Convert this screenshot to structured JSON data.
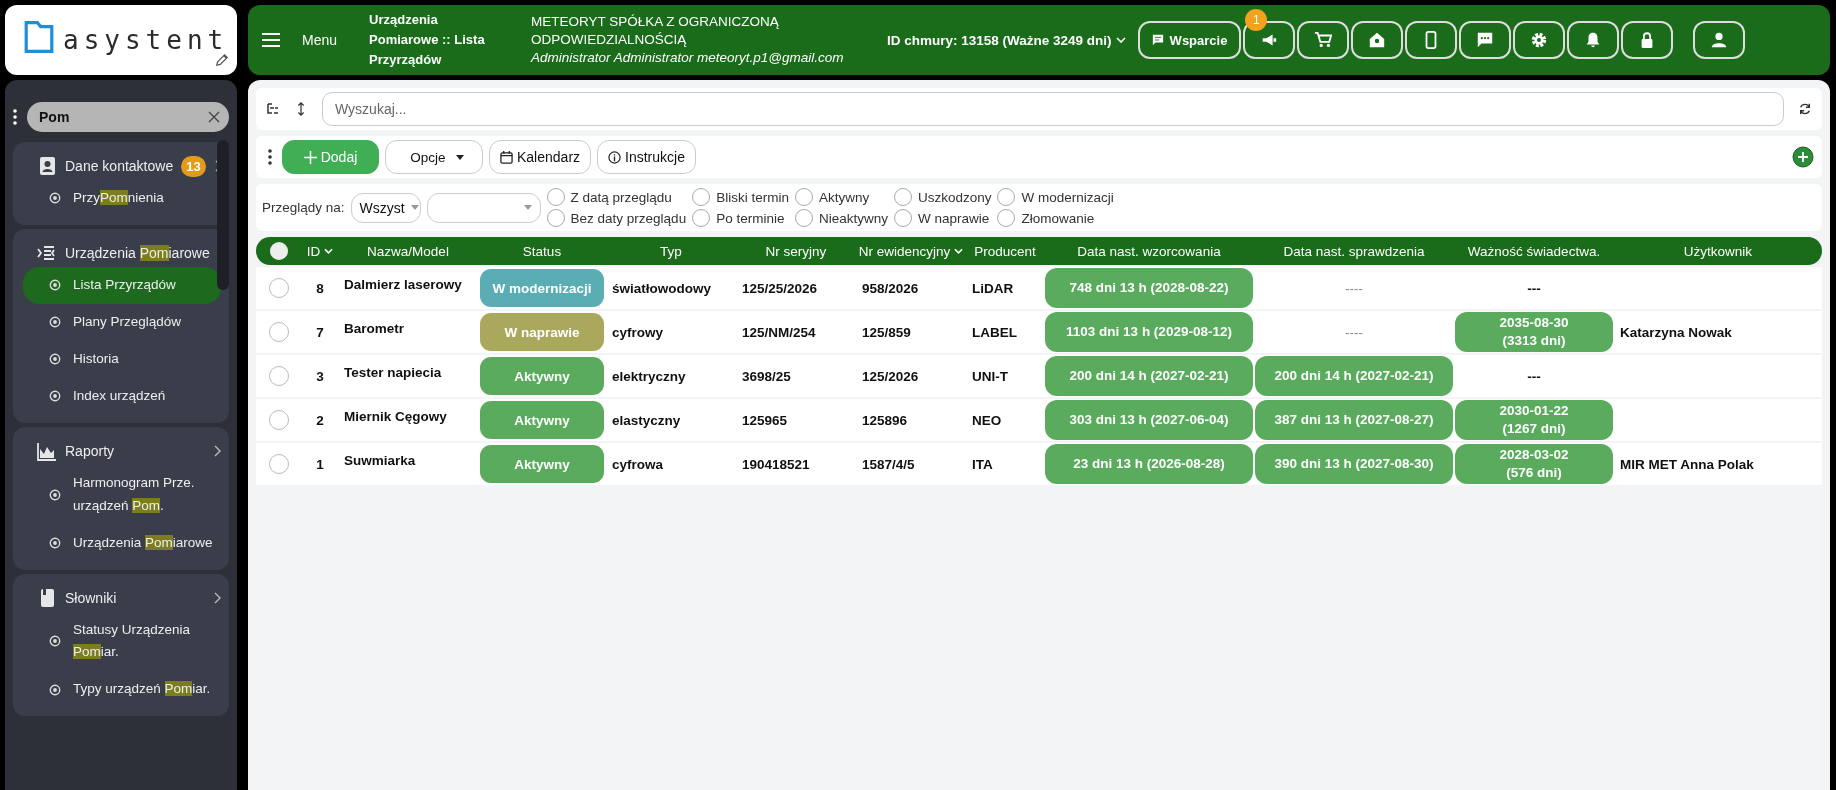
{
  "logo": "asystent",
  "topbar": {
    "menu_label": "Menu",
    "page_title": "Urządzenia Pomiarowe :: Lista Przyrządów",
    "company": "METEORYT SPÓŁKA Z OGRANICZONĄ ODPOWIEDZIALNOŚCIĄ",
    "user": "Administrator Administrator meteoryt.p1@gmail.com",
    "cloud_id": "ID chmury: 13158 (Ważne 3249 dni)",
    "support_button": "Wsparcie",
    "icon_buttons": [
      {
        "kind": "megaphone",
        "badge": "1"
      },
      {
        "kind": "cart"
      },
      {
        "kind": "home"
      },
      {
        "kind": "phone"
      },
      {
        "kind": "chat"
      },
      {
        "kind": "gear"
      },
      {
        "kind": "bell"
      },
      {
        "kind": "lock"
      },
      {
        "kind": "user"
      }
    ]
  },
  "sidebar": {
    "search": {
      "value": "Pom"
    },
    "groups": [
      {
        "kind": "contact",
        "label": [
          {
            "text": "Dane kontaktowe",
            "highlight": false
          }
        ],
        "badge": "13",
        "items": [
          {
            "selected": false,
            "label": [
              {
                "text": "Przy",
                "highlight": false
              },
              {
                "text": "Pom",
                "highlight": true
              },
              {
                "text": "nienia",
                "highlight": false
              }
            ]
          }
        ]
      },
      {
        "kind": "devices",
        "label": [
          {
            "text": "Urządzenia ",
            "highlight": false
          },
          {
            "text": "Pom",
            "highlight": true
          },
          {
            "text": "iarowe",
            "highlight": false
          }
        ],
        "items": [
          {
            "selected": true,
            "label": [
              {
                "text": "Lista Przyrządów",
                "highlight": false
              }
            ]
          },
          {
            "selected": false,
            "label": [
              {
                "text": "Plany Przeglądów",
                "highlight": false
              }
            ]
          },
          {
            "selected": false,
            "label": [
              {
                "text": "Historia",
                "highlight": false
              }
            ]
          },
          {
            "selected": false,
            "label": [
              {
                "text": "Index urządzeń",
                "highlight": false
              }
            ]
          }
        ]
      },
      {
        "kind": "chart",
        "label": [
          {
            "text": "Raporty",
            "highlight": false
          }
        ],
        "items": [
          {
            "selected": false,
            "label": [
              {
                "text": "Harmonogram Prze. urządzeń ",
                "highlight": false
              },
              {
                "text": "Pom",
                "highlight": true
              },
              {
                "text": ".",
                "highlight": false
              }
            ]
          },
          {
            "selected": false,
            "label": [
              {
                "text": "Urządzenia ",
                "highlight": false
              },
              {
                "text": "Pom",
                "highlight": true
              },
              {
                "text": "iarowe",
                "highlight": false
              }
            ]
          }
        ]
      },
      {
        "kind": "book",
        "label": [
          {
            "text": "Słowniki",
            "highlight": false
          }
        ],
        "items": [
          {
            "selected": false,
            "label": [
              {
                "text": "Statusy Urządzenia ",
                "highlight": false
              },
              {
                "text": "Pom",
                "highlight": true
              },
              {
                "text": "iar.",
                "highlight": false
              }
            ]
          },
          {
            "selected": false,
            "label": [
              {
                "text": "Typy urządzeń ",
                "highlight": false
              },
              {
                "text": "Pom",
                "highlight": true
              },
              {
                "text": "iar.",
                "highlight": false
              }
            ]
          }
        ]
      }
    ]
  },
  "search": {
    "placeholder": "Wyszukaj..."
  },
  "toolbar": {
    "add": "Dodaj",
    "options": "Opcje",
    "calendar": "Kalendarz",
    "instructions": "Instrukcje"
  },
  "filters": {
    "label": "Przeglądy na:",
    "select": "Wszyst",
    "options": [
      {
        "label": "Z datą przeglądu",
        "checked": false
      },
      {
        "label": "Bez daty przeglądu",
        "checked": false
      },
      {
        "label": "Bliski termin",
        "checked": false
      },
      {
        "label": "Po terminie",
        "checked": false
      },
      {
        "label": "Aktywny",
        "checked": false
      },
      {
        "label": "Nieaktywny",
        "checked": false
      },
      {
        "label": "Uszkodzony",
        "checked": false
      },
      {
        "label": "W naprawie",
        "checked": false
      },
      {
        "label": "W modernizacji",
        "checked": false
      },
      {
        "label": "Złomowanie",
        "checked": false
      }
    ]
  },
  "table": {
    "all_selected": false,
    "columns": [
      {
        "label": "ID",
        "sorted": true
      },
      {
        "label": "Nazwa/Model",
        "sorted": false
      },
      {
        "label": "Status",
        "sorted": false
      },
      {
        "label": "Typ",
        "sorted": false
      },
      {
        "label": "Nr seryjny",
        "sorted": false
      },
      {
        "label": "Nr ewidencyjny",
        "sorted": true
      },
      {
        "label": "Producent",
        "sorted": false
      },
      {
        "label": "Data nast. wzorcowania",
        "sorted": false
      },
      {
        "label": "Data nast. sprawdzenia",
        "sorted": false
      },
      {
        "label": "Ważność świadectwa.",
        "sorted": false
      },
      {
        "label": "Użytkownik",
        "sorted": false
      }
    ],
    "rows": [
      {
        "selected": false,
        "id": "8",
        "name": "Dalmierz laserowy",
        "status": {
          "label": "W modernizacji",
          "color": "#5aadb3"
        },
        "type": "światłowodowy",
        "serial": "125/25/2026",
        "inventory": "958/2026",
        "producer": "LiDAR",
        "calibration": {
          "kind": "pill",
          "text": "748 dni 13 h (2028-08-22)"
        },
        "check": {
          "kind": "muted",
          "text": "----"
        },
        "certificate": {
          "kind": "plain",
          "text": "---"
        }
      },
      {
        "selected": false,
        "id": "7",
        "name": "Barometr",
        "status": {
          "label": "W naprawie",
          "color": "#aaa85c"
        },
        "type": "cyfrowy",
        "serial": "125/NM/254",
        "inventory": "125/859",
        "producer": "LABEL",
        "calibration": {
          "kind": "pill",
          "text": "1103 dni 13 h (2029-08-12)"
        },
        "check": {
          "kind": "muted",
          "text": "----"
        },
        "certificate": {
          "kind": "pill",
          "text": "2035-08-30\n(3313 dni)"
        },
        "user": "Katarzyna Nowak"
      },
      {
        "selected": false,
        "id": "3",
        "name": "Tester napiecia",
        "status": {
          "label": "Aktywny",
          "color": "#5aab5e"
        },
        "type": "elektryczny",
        "serial": "3698/25",
        "inventory": "125/2026",
        "producer": "UNI-T",
        "calibration": {
          "kind": "pill",
          "text": "200 dni 14 h (2027-02-21)"
        },
        "check": {
          "kind": "pill",
          "text": "200 dni 14 h (2027-02-21)"
        },
        "certificate": {
          "kind": "plain",
          "text": "---"
        }
      },
      {
        "selected": false,
        "id": "2",
        "name": "Miernik Cęgowy",
        "status": {
          "label": "Aktywny",
          "color": "#5aab5e"
        },
        "type": "elastyczny",
        "serial": "125965",
        "inventory": "125896",
        "producer": "NEO",
        "calibration": {
          "kind": "pill",
          "text": "303 dni 13 h (2027-06-04)"
        },
        "check": {
          "kind": "pill",
          "text": "387 dni 13 h (2027-08-27)"
        },
        "certificate": {
          "kind": "pill",
          "text": "2030-01-22\n(1267 dni)"
        }
      },
      {
        "selected": false,
        "id": "1",
        "name": "Suwmiarka",
        "status": {
          "label": "Aktywny",
          "color": "#5aab5e"
        },
        "type": "cyfrowa",
        "serial": "190418521",
        "inventory": "1587/4/5",
        "producer": "ITA",
        "calibration": {
          "kind": "pill",
          "text": "23 dni 13 h (2026-08-28)"
        },
        "check": {
          "kind": "pill",
          "text": "390 dni 13 h (2027-08-30)"
        },
        "certificate": {
          "kind": "pill",
          "text": "2028-03-02\n(576 dni)"
        },
        "user": "MIR MET Anna Polak"
      }
    ]
  }
}
